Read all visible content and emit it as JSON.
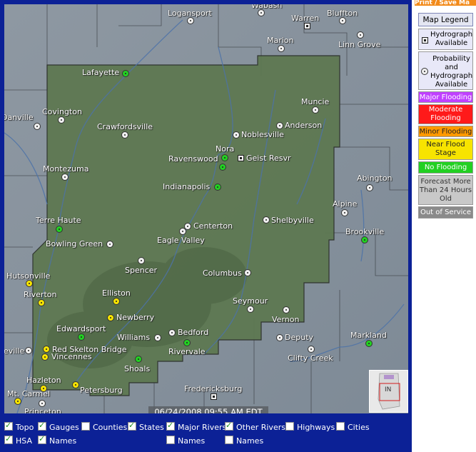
{
  "print_button": "Print / Save Ma",
  "timestamp": "06/24/2008 09:55 AM EDT",
  "inset_label": "IN",
  "colors": {
    "no_flooding": "#22d022",
    "near_flood_stage": "#f7e400",
    "minor_flooding": "#ff9900",
    "moderate_flooding": "#ff1a1a",
    "major_flooding": "#c040ff",
    "forecast_old": "#c8c8c8",
    "out_of_service": "#8a8a8a",
    "hsa_fill": "#5d7650"
  },
  "legend": {
    "button": "Map Legend",
    "hydrograph": "Hydrograph Available",
    "probability": "Probability and Hydrograph Available",
    "major": "Major Flooding",
    "moderate": "Moderate Flooding",
    "minor": "Minor Flooding",
    "near": "Near Flood Stage",
    "none": "No Flooding",
    "old": "Forecast More Than 24 Hours Old",
    "out": "Out of Service"
  },
  "places": {
    "logansport": "Logansport",
    "wabash": "Wabash",
    "warren": "Warren",
    "bluffton": "Bluffton",
    "marion": "Marion",
    "linn_grove": "Linn Grove",
    "lafayette": "Lafayette",
    "muncie": "Muncie",
    "danville": "Danville",
    "covington": "Covington",
    "anderson": "Anderson",
    "crawfordsville": "Crawfordsville",
    "noblesville": "Noblesville",
    "nora": "Nora",
    "ravenswood": "Ravenswood",
    "geist": "Geist Resvr",
    "montezuma": "Montezuma",
    "abington": "Abington",
    "indianapolis": "Indianapolis",
    "alpine": "Alpine",
    "terre_haute": "Terre Haute",
    "shelbyville": "Shelbyville",
    "centerton": "Centerton",
    "brookville": "Brookville",
    "eagle_valley": "Eagle Valley",
    "bowling_green": "Bowling Green",
    "spencer": "Spencer",
    "hutsonville": "Hutsonville",
    "columbus": "Columbus",
    "riverton": "Riverton",
    "elliston": "Elliston",
    "seymour": "Seymour",
    "newberry": "Newberry",
    "vernon": "Vernon",
    "edwardsport": "Edwardsport",
    "williams": "Williams",
    "bedford": "Bedford",
    "deputy": "Deputy",
    "markland": "Markland",
    "neville": "eville",
    "red_skelton": "Red Skelton Bridge",
    "rivervale": "Rivervale",
    "clifty_creek": "Clifty Creek",
    "vincennes": "Vincennes",
    "shoals": "Shoals",
    "hazleton": "Hazleton",
    "petersburg": "Petersburg",
    "fredericksburg": "Fredericksburg",
    "mt_carmel": "Mt. Carmel",
    "princeton": "Princeton"
  },
  "controls": {
    "topo": "Topo",
    "gauges": "Gauges",
    "counties": "Counties",
    "states": "States",
    "major_rivers": "Major Rivers",
    "other_rivers": "Other Rivers",
    "highways": "Highways",
    "cities": "Cities",
    "hsa": "HSA",
    "names1": "Names",
    "names2": "Names",
    "names3": "Names"
  }
}
